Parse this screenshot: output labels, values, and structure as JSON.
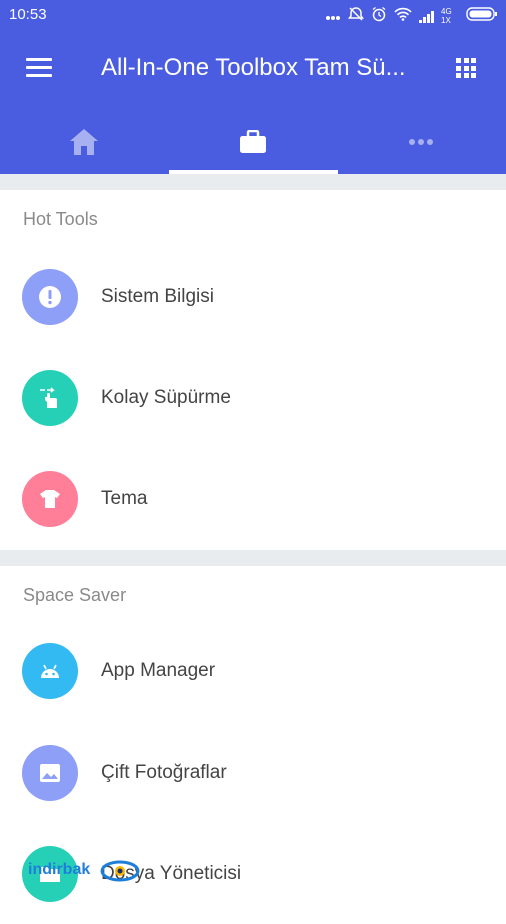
{
  "status_bar": {
    "time": "10:53",
    "network_label": "4G",
    "sim_label": "1X",
    "icons": [
      "more-dots-icon",
      "alarm-off-icon",
      "alarm-icon",
      "wifi-icon",
      "signal-icon",
      "battery-icon"
    ]
  },
  "toolbar": {
    "title": "All-In-One Toolbox Tam Sü...",
    "menu_icon": "hamburger-menu-icon",
    "apps_icon": "grid-apps-icon"
  },
  "tabs": [
    {
      "icon": "home-icon",
      "active": false
    },
    {
      "icon": "toolbox-briefcase-icon",
      "active": true
    },
    {
      "icon": "more-horizontal-icon",
      "active": false
    }
  ],
  "sections": [
    {
      "title": "Hot Tools",
      "items": [
        {
          "label": "Sistem Bilgisi",
          "icon": "info-exclamation-icon",
          "color": "#8d9ff7"
        },
        {
          "label": "Kolay Süpürme",
          "icon": "swipe-hand-icon",
          "color": "#26d0b7"
        },
        {
          "label": "Tema",
          "icon": "tshirt-icon",
          "color": "#ff7f98"
        }
      ]
    },
    {
      "title": "Space Saver",
      "items": [
        {
          "label": "App Manager",
          "icon": "android-icon",
          "color": "#33baf2"
        },
        {
          "label": "Çift Fotoğraflar",
          "icon": "image-icon",
          "color": "#8d9ff7"
        },
        {
          "label": "Dosya Yöneticisi",
          "icon": "folder-icon",
          "color": "#26d0b7"
        }
      ]
    }
  ],
  "watermark": {
    "text": "indirbak"
  },
  "colors": {
    "app_bar": "#4a5de0",
    "divider": "#e9ecef",
    "section_title": "#8a8a8a"
  }
}
